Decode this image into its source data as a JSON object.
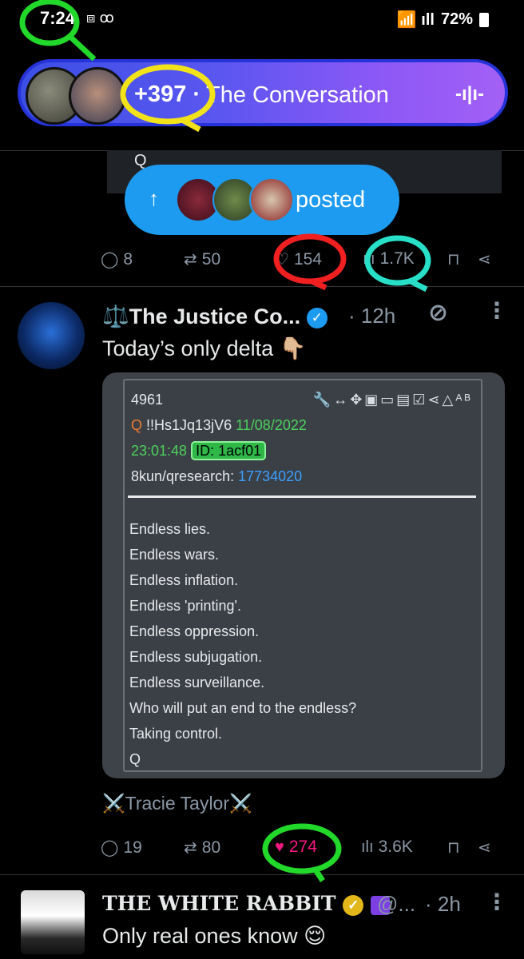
{
  "status_bar": {
    "time": "7:24",
    "left_icons": "⧈ ꝏ",
    "signal": "📶 ıll",
    "battery": "72%"
  },
  "spaces": {
    "count": "+397 ·",
    "title": "The Conversation",
    "wave_icon": "-ı|ı-"
  },
  "quote_remnant": {
    "text": "Q"
  },
  "posted_pill": {
    "label": "posted",
    "arrow": "↑"
  },
  "prev_actions": {
    "replies": "8",
    "reposts": "50",
    "likes": "154",
    "views": "1.7K"
  },
  "tweet1": {
    "name": "⚖️The Justice Co...",
    "time": "· 12h",
    "text": "Today’s only delta 👇🏼",
    "qcard": {
      "post_no": "4961",
      "q_label": "Q",
      "tripcode": "!!Hs1Jq13jV6",
      "date": "11/08/2022",
      "clock": "23:01:48",
      "id_label": "ID: 1acf01",
      "board": "8kun/qresearch:",
      "thread": "17734020",
      "lines": [
        "Endless lies.",
        "Endless wars.",
        "Endless inflation.",
        "Endless 'printing'.",
        "Endless oppression.",
        "Endless subjugation.",
        "Endless surveillance.",
        "Who will put an end to the endless?",
        "Taking control.",
        "Q"
      ]
    },
    "footer": "⚔️Tracie Taylor⚔️",
    "actions": {
      "replies": "19",
      "reposts": "80",
      "likes": "274",
      "views": "3.6K"
    }
  },
  "tweet2": {
    "name": "THE WHITE RABBIT",
    "handle": "@...",
    "time": "· 2h",
    "text": "Only real ones know 😌"
  },
  "colors": {
    "accent_blue": "#1d9bf0",
    "like_pink": "#f91880",
    "annotation_green": "#22d82a",
    "annotation_yellow": "#f2e21a",
    "annotation_red": "#f02020",
    "annotation_cyan": "#28e0c8"
  }
}
